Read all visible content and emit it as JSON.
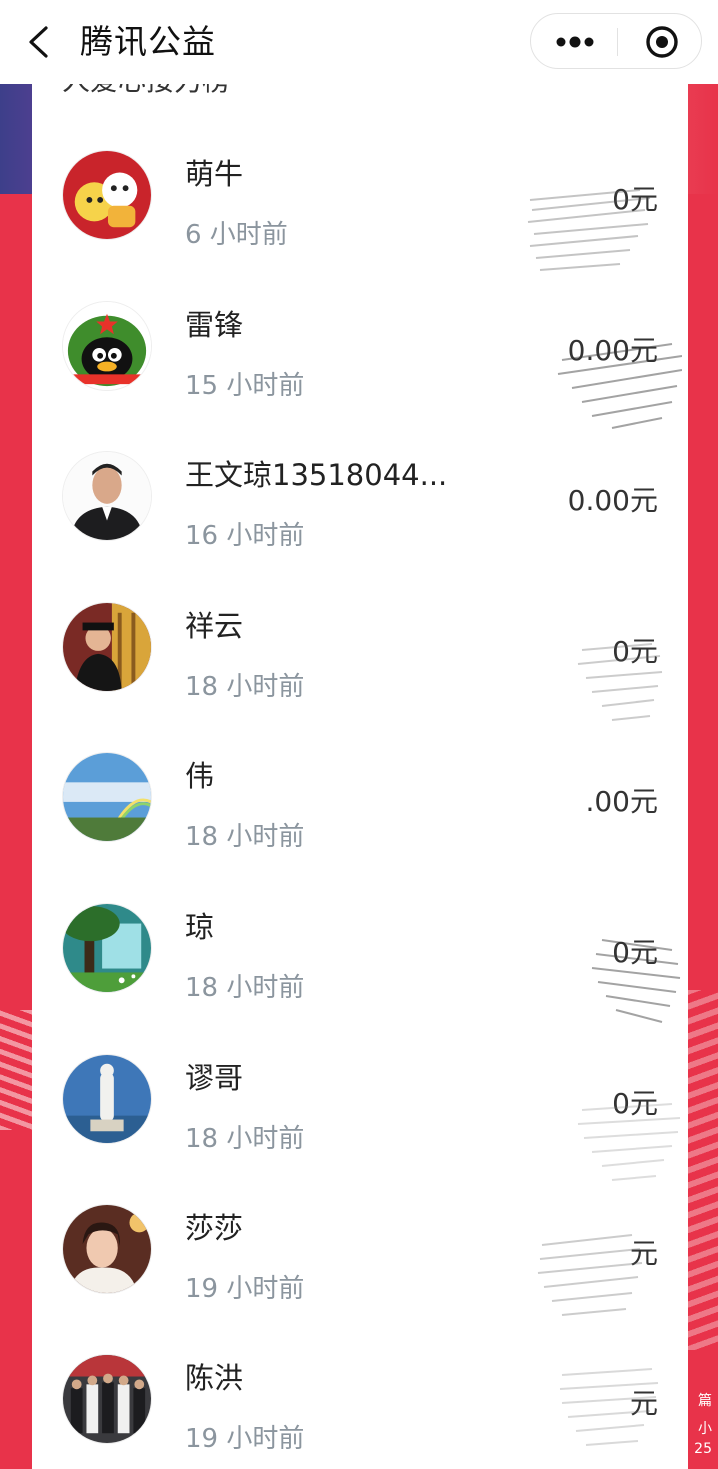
{
  "nav": {
    "title": "腾讯公益"
  },
  "list": {
    "header_partial": "人爱心接力榜"
  },
  "donors": [
    {
      "name": "萌牛",
      "time": "6 小时前",
      "amount": "0元"
    },
    {
      "name": "雷锋",
      "time": "15 小时前",
      "amount": "0.00元"
    },
    {
      "name": "王文琼13518044...",
      "time": "16 小时前",
      "amount": "0.00元"
    },
    {
      "name": "祥云",
      "time": "18 小时前",
      "amount": "0元"
    },
    {
      "name": "伟",
      "time": "18 小时前",
      "amount": ".00元"
    },
    {
      "name": "琼",
      "time": "18 小时前",
      "amount": "0元"
    },
    {
      "name": "谬哥",
      "time": "18 小时前",
      "amount": "0元"
    },
    {
      "name": "莎莎",
      "time": "19 小时前",
      "amount": "元"
    },
    {
      "name": "陈洪",
      "time": "19 小时前",
      "amount": "元"
    }
  ],
  "side_text": {
    "line1": "篇",
    "line2": "小",
    "line3": "25"
  },
  "colors": {
    "background": "#e8334a",
    "time_text": "#8b959e"
  }
}
